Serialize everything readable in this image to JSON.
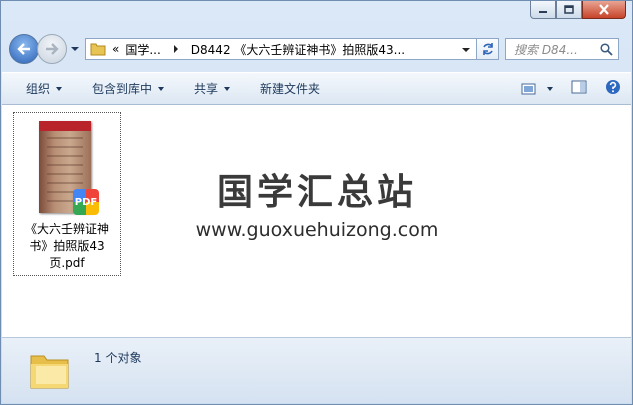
{
  "window": {
    "controls": [
      "minimize",
      "maximize",
      "close"
    ]
  },
  "address": {
    "chevron": "«",
    "crumb1": "国学...",
    "crumb2": "D8442 《大六壬辨证神书》拍照版43...",
    "search_placeholder": "搜索 D84..."
  },
  "toolbar": {
    "organize": "组织",
    "include_library": "包含到库中",
    "share": "共享",
    "new_folder": "新建文件夹"
  },
  "files": [
    {
      "name": "《大六壬辨证神书》拍照版43页.pdf",
      "type": "pdf",
      "badge": "PDF"
    }
  ],
  "watermark": {
    "title": "国学汇总站",
    "url": "www.guoxuehuizong.com"
  },
  "status": {
    "count_text": "1 个对象"
  },
  "colors": {
    "accent": "#2c63b8",
    "toolbar_text": "#1e395b"
  }
}
